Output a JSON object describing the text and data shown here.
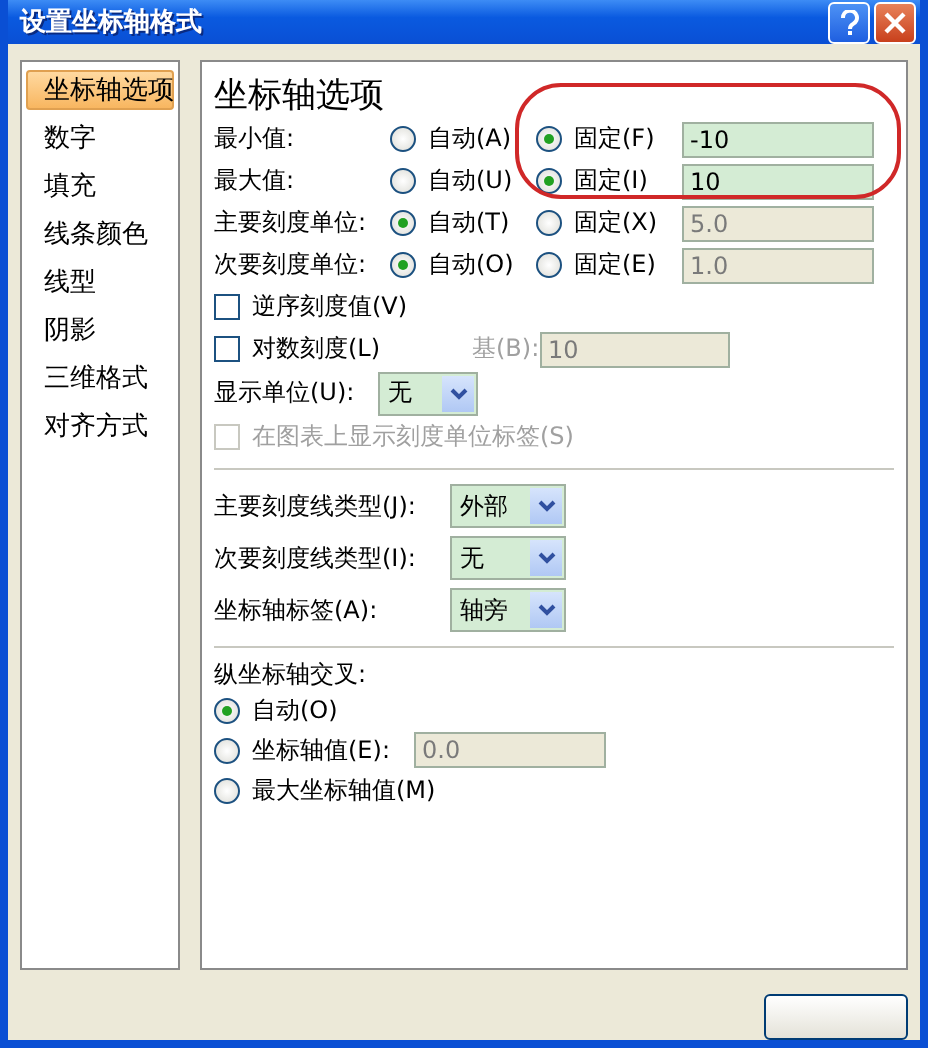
{
  "window": {
    "title": "设置坐标轴格式"
  },
  "sidebar": {
    "items": [
      {
        "label": "坐标轴选项",
        "selected": true
      },
      {
        "label": "数字",
        "selected": false
      },
      {
        "label": "填充",
        "selected": false
      },
      {
        "label": "线条颜色",
        "selected": false
      },
      {
        "label": "线型",
        "selected": false
      },
      {
        "label": "阴影",
        "selected": false
      },
      {
        "label": "三维格式",
        "selected": false
      },
      {
        "label": "对齐方式",
        "selected": false
      }
    ]
  },
  "panel": {
    "heading": "坐标轴选项",
    "bound_rows": [
      {
        "label": "最小值:",
        "options": [
          {
            "label": "自动(A)",
            "selected": false
          },
          {
            "label": "固定(F)",
            "selected": true
          }
        ],
        "field": {
          "value": "-10",
          "disabled": false
        }
      },
      {
        "label": "最大值:",
        "options": [
          {
            "label": "自动(U)",
            "selected": false
          },
          {
            "label": "固定(I)",
            "selected": true
          }
        ],
        "field": {
          "value": "10",
          "disabled": false
        }
      },
      {
        "label": "主要刻度单位:",
        "options": [
          {
            "label": "自动(T)",
            "selected": true
          },
          {
            "label": "固定(X)",
            "selected": false
          }
        ],
        "field": {
          "value": "5.0",
          "disabled": true
        }
      },
      {
        "label": "次要刻度单位:",
        "options": [
          {
            "label": "自动(O)",
            "selected": true
          },
          {
            "label": "固定(E)",
            "selected": false
          }
        ],
        "field": {
          "value": "1.0",
          "disabled": true
        }
      }
    ],
    "checkboxes": [
      {
        "label": "逆序刻度值(V)",
        "checked": false,
        "disabled": false
      },
      {
        "label": "对数刻度(L)",
        "checked": false,
        "disabled": false,
        "base": {
          "label": "基(B):",
          "value": "10",
          "disabled": true
        }
      }
    ],
    "display_unit": {
      "label": "显示单位(U):",
      "value": "无"
    },
    "unit_label_checkbox": {
      "label": "在图表上显示刻度单位标签(S)",
      "checked": false,
      "disabled": true
    },
    "dropdowns": [
      {
        "label": "主要刻度线类型(J):",
        "value": "外部"
      },
      {
        "label": "次要刻度线类型(I):",
        "value": "无"
      },
      {
        "label": "坐标轴标签(A):",
        "value": "轴旁"
      }
    ],
    "crosses": {
      "heading": "纵坐标轴交叉:",
      "options": [
        {
          "label": "自动(O)",
          "selected": true
        },
        {
          "label": "坐标轴值(E):",
          "selected": false,
          "field": {
            "value": "0.0",
            "disabled": true
          }
        },
        {
          "label": "最大坐标轴值(M)",
          "selected": false
        }
      ]
    }
  }
}
